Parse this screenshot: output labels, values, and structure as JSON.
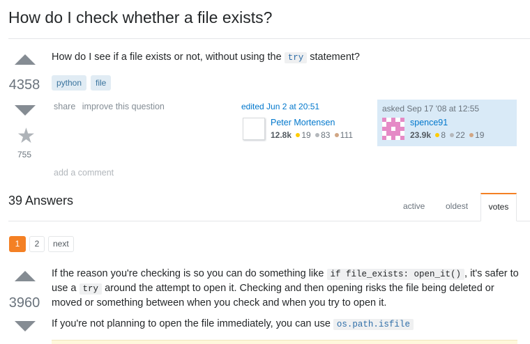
{
  "question": {
    "title": "How do I check whether a file exists?",
    "votes": "4358",
    "favorites": "755",
    "body_prefix": "How do I see if a file exists or not, without using the",
    "body_code": "try",
    "body_suffix": "statement?",
    "tags": [
      "python",
      "file"
    ],
    "menu": {
      "share": "share",
      "improve": "improve this question"
    },
    "edited": {
      "label": "edited Jun 2 at 20:51",
      "user": "Peter Mortensen",
      "reputation": "12.8k",
      "gold": "19",
      "silver": "83",
      "bronze": "111"
    },
    "asked": {
      "label": "asked Sep 17 '08 at 12:55",
      "user": "spence91",
      "reputation": "23.9k",
      "gold": "8",
      "silver": "22",
      "bronze": "19"
    },
    "add_comment": "add a comment"
  },
  "answers_header": {
    "count_label": "39 Answers",
    "tabs": [
      "active",
      "oldest",
      "votes"
    ],
    "selected_tab": "votes"
  },
  "pager": {
    "pages": [
      "1",
      "2"
    ],
    "current": "1",
    "next": "next"
  },
  "answer": {
    "votes": "3960",
    "p1_a": "If the reason you're checking is so you can do something like",
    "p1_code1": "if file_exists: open_it()",
    "p1_b": ", it's safer to use a",
    "p1_code2": "try",
    "p1_c": "around the attempt to open it. Checking and then opening risks the file being deleted or moved or something between when you check and when you try to open it.",
    "p2_a": "If you're not planning to open the file immediately, you can use",
    "p2_code": "os.path.isfile"
  },
  "colors": {
    "accent": "#f48024",
    "link": "#0077cc",
    "tag_bg": "#e1ecf4",
    "tag_text": "#39739d",
    "gold": "#ffcc01",
    "silver": "#b4b8bc",
    "bronze": "#d1a684",
    "asked_bg": "#d9eaf7",
    "identicon": "#e58ac6"
  },
  "icons": {
    "upvote": "triangle-up",
    "downvote": "triangle-down",
    "favorite": "star"
  }
}
